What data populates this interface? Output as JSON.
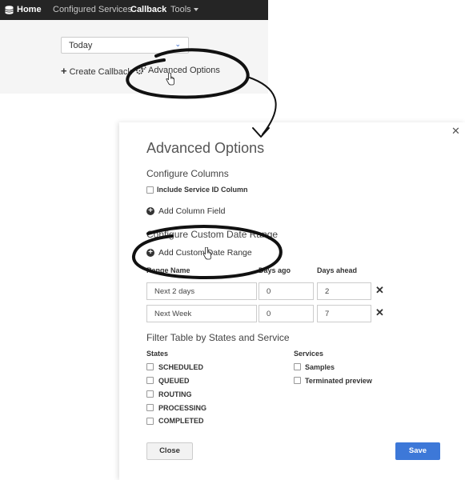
{
  "navbar": {
    "home": "Home",
    "configured_services": "Configured Services",
    "callback": "Callback",
    "tools": "Tools"
  },
  "filter": {
    "date_value": "Today"
  },
  "actions": {
    "create_callback": "Create Callback",
    "advanced_options": "Advanced Options"
  },
  "modal": {
    "title": "Advanced Options",
    "configure_columns": {
      "heading": "Configure Columns",
      "include_service_id": "Include Service ID Column",
      "add_column_field": "Add Column Field"
    },
    "custom_date_range": {
      "heading": "Configure Custom Date Range",
      "add_custom_date_range": "Add Custom Date Range",
      "columns": [
        "Range Name",
        "Days ago",
        "Days ahead"
      ],
      "rows": [
        {
          "name": "Next 2 days",
          "days_ago": "0",
          "days_ahead": "2"
        },
        {
          "name": "Next Week",
          "days_ago": "0",
          "days_ahead": "7"
        }
      ]
    },
    "filter_table": {
      "heading": "Filter Table by States and Service",
      "states_label": "States",
      "states": [
        "SCHEDULED",
        "QUEUED",
        "ROUTING",
        "PROCESSING",
        "COMPLETED"
      ],
      "services_label": "Services",
      "services": [
        "Samples",
        "Terminated preview"
      ]
    },
    "close_button": "Close",
    "save_button": "Save"
  },
  "colors": {
    "navbar": "#252525",
    "save_button": "#3d78d8",
    "link_chevron": "#2f62c9"
  },
  "icons": [
    "home-icon",
    "chevron-down-icon",
    "plus-icon",
    "gears-icon",
    "hand-cursor-icon",
    "close-icon",
    "plus-circle-icon",
    "remove-x-icon"
  ]
}
